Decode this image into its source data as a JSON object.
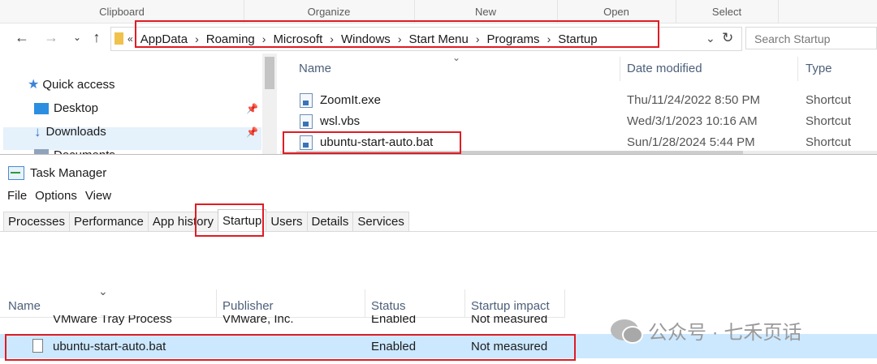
{
  "explorer": {
    "ribbon_groups": [
      "Clipboard",
      "Organize",
      "New",
      "Open",
      "Select"
    ],
    "breadcrumbs": [
      "AppData",
      "Roaming",
      "Microsoft",
      "Windows",
      "Start Menu",
      "Programs",
      "Startup"
    ],
    "overflow_chevron": "«",
    "search_placeholder": "Search Startup",
    "nav_items": [
      {
        "label": "Quick access",
        "icon": "star-icon"
      },
      {
        "label": "Desktop",
        "icon": "desktop-icon"
      },
      {
        "label": "Downloads",
        "icon": "download-arrow-icon"
      },
      {
        "label": "Documents",
        "icon": "documents-icon"
      }
    ],
    "columns": [
      "Name",
      "Date modified",
      "Type"
    ],
    "files": [
      {
        "name": "ZoomIt.exe",
        "date": "Thu/11/24/2022 8:50 PM",
        "type": "Shortcut"
      },
      {
        "name": "wsl.vbs",
        "date": "Wed/3/1/2023 10:16 AM",
        "type": "Shortcut"
      },
      {
        "name": "ubuntu-start-auto.bat",
        "date": "Sun/1/28/2024 5:44 PM",
        "type": "Shortcut"
      }
    ]
  },
  "taskmanager": {
    "title": "Task Manager",
    "menu": [
      "File",
      "Options",
      "View"
    ],
    "tabs": [
      "Processes",
      "Performance",
      "App history",
      "Startup",
      "Users",
      "Details",
      "Services"
    ],
    "active_tab": "Startup",
    "columns": [
      "Name",
      "Publisher",
      "Status",
      "Startup impact"
    ],
    "rows": [
      {
        "name": "VMware Tray Process",
        "publisher": "VMware, Inc.",
        "status": "Enabled",
        "impact": "Not measured"
      },
      {
        "name": "ubuntu-start-auto.bat",
        "publisher": "",
        "status": "Enabled",
        "impact": "Not measured"
      }
    ]
  },
  "watermark": "公众号 · 七禾页话",
  "colors": {
    "highlight_red": "#e01b24",
    "selection": "#cce8ff",
    "header_text": "#4c607a"
  }
}
